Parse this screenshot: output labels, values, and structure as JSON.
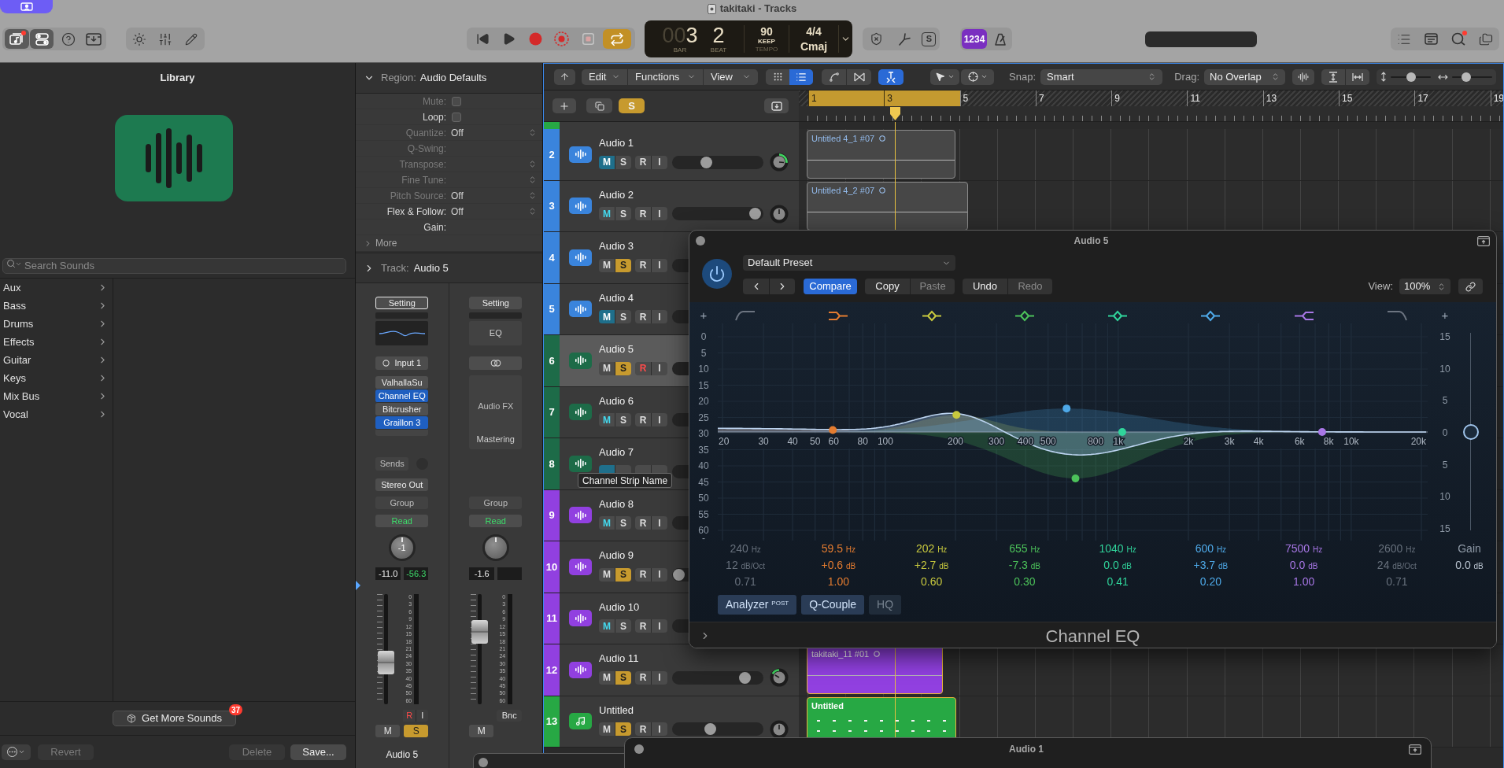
{
  "window": {
    "title": "takitaki - Tracks"
  },
  "toolbar": {
    "library_on": true,
    "inspector_on": true,
    "cycle_on": true,
    "solo_label": "S",
    "count_in": {
      "label": "1234",
      "on": true
    },
    "metronome_on": false,
    "lcd": {
      "bar_lead": "00",
      "bar": "3",
      "beat": "2",
      "bar_label": "BAR",
      "beat_label": "BEAT",
      "tempo": "90",
      "tempo_mode": "KEEP",
      "tempo_label": "TEMPO",
      "signature": "4/4",
      "key": "Cmaj"
    }
  },
  "library": {
    "title": "Library",
    "search": {
      "placeholder": "Search Sounds"
    },
    "categories": [
      "Aux",
      "Bass",
      "Drums",
      "Effects",
      "Guitar",
      "Keys",
      "Mix Bus",
      "Vocal"
    ],
    "get_more": {
      "label": "Get More Sounds",
      "badge": "37"
    },
    "buttons": [
      {
        "label": "Revert",
        "disabled": true
      },
      {
        "label": "Delete",
        "disabled": true
      },
      {
        "label": "Save...",
        "disabled": false
      }
    ]
  },
  "inspector": {
    "region": {
      "label": "Region:",
      "name": "Audio Defaults",
      "expanded": true,
      "rows": [
        {
          "label": "Mute:",
          "kind": "checkbox",
          "checked": false,
          "disabled": true
        },
        {
          "label": "Loop:",
          "kind": "checkbox",
          "checked": false,
          "disabled": false
        },
        {
          "label": "Quantize:",
          "kind": "popup",
          "value": "Off",
          "disabled": true
        },
        {
          "label": "Q-Swing:",
          "kind": "plain",
          "disabled": true
        },
        {
          "label": "Transpose:",
          "kind": "popup",
          "disabled": true
        },
        {
          "label": "Fine Tune:",
          "kind": "popup",
          "disabled": true
        },
        {
          "label": "Pitch Source:",
          "kind": "popup",
          "value": "Off",
          "disabled": true
        },
        {
          "label": "Flex & Follow:",
          "kind": "popup",
          "value": "Off",
          "disabled": false
        },
        {
          "label": "Gain:",
          "kind": "plain",
          "disabled": false
        }
      ],
      "more": "More"
    },
    "track": {
      "label": "Track:",
      "name": "Audio 5",
      "expanded": false
    },
    "strips": [
      {
        "selected": true,
        "setting": "Setting",
        "eq": {
          "kind": "curve"
        },
        "input": {
          "kind": "mono",
          "label": "Input 1"
        },
        "plugins": [
          {
            "name": "ValhallaSu",
            "selected": false
          },
          {
            "name": "Channel EQ",
            "selected": true
          },
          {
            "name": "Bitcrusher",
            "selected": false
          },
          {
            "name": "Graillon 3",
            "selected": true
          }
        ],
        "sends": "Sends",
        "output": "Stereo Out",
        "group": "Group",
        "automation": "Read",
        "pan_label": "-1",
        "volume": "-11.0",
        "peak": "-56.3",
        "fader": {
          "level": 0.38
        },
        "meter_scale": [
          "0",
          "3",
          "6",
          "9",
          "12",
          "15",
          "18",
          "21",
          "24",
          "30",
          "35",
          "40",
          "45",
          "50",
          "60"
        ],
        "buttons_top": [
          {
            "label": "R",
            "kind": "rec",
            "on": true
          },
          {
            "label": "I",
            "kind": "input",
            "on": false
          }
        ],
        "buttons_bottom": [
          {
            "label": "M",
            "kind": "mute",
            "on": false
          },
          {
            "label": "S",
            "kind": "solo",
            "on": true
          }
        ],
        "name": "Audio 5"
      },
      {
        "selected": false,
        "setting": "Setting",
        "eq": {
          "kind": "label",
          "label": "EQ"
        },
        "input": {
          "kind": "stereo"
        },
        "fx_box": {
          "placeholder": "Audio FX",
          "slot": "Mastering"
        },
        "group": "Group",
        "automation": "Read",
        "volume": "-1.6",
        "fader": {
          "level": 0.66
        },
        "meter_scale": [
          "0",
          "3",
          "6",
          "9",
          "12",
          "15",
          "18",
          "21",
          "24",
          "30",
          "35",
          "40",
          "45",
          "50",
          "60"
        ],
        "buttons_top": [
          {
            "label": "Bnc",
            "kind": "bounce",
            "on": false
          }
        ],
        "buttons_bottom": [
          {
            "label": "M",
            "kind": "mute",
            "on": false
          }
        ]
      }
    ]
  },
  "tracks_toolbar": {
    "menus": [
      "Edit",
      "Functions",
      "View"
    ],
    "grid_view_on": false,
    "list_view_on": true,
    "catch_on": true,
    "snap": {
      "label": "Snap:",
      "value": "Smart"
    },
    "drag": {
      "label": "Drag:",
      "value": "No Overlap"
    },
    "vertical_zoom": {
      "level": 0.5
    },
    "horizontal_zoom": {
      "level": 0.3
    }
  },
  "track_list_bar": {
    "solo": {
      "label": "S",
      "on": true
    }
  },
  "ruler": {
    "bars": [
      {
        "label": "1",
        "in_cycle": true
      },
      {
        "label": "3",
        "in_cycle": true
      },
      {
        "label": "5",
        "in_cycle": false
      },
      {
        "label": "7",
        "in_cycle": false
      },
      {
        "label": "9",
        "in_cycle": false
      },
      {
        "label": "11",
        "in_cycle": false
      },
      {
        "label": "13",
        "in_cycle": false
      },
      {
        "label": "15",
        "in_cycle": false
      },
      {
        "label": "17",
        "in_cycle": false
      },
      {
        "label": "19",
        "in_cycle": false
      }
    ],
    "playhead": {
      "level": 0.136
    }
  },
  "partial_track": {
    "color": "#27a844"
  },
  "tracks": [
    {
      "number": "2",
      "name": "Audio 1",
      "color": "#3a84dc",
      "kind": "audio",
      "selected": false,
      "solo_muted": false,
      "buttons": [
        {
          "label": "M",
          "kind": "mute",
          "on": true
        },
        {
          "label": "S",
          "kind": "solo",
          "on": false
        },
        {
          "label": "R",
          "kind": "rec",
          "on": false
        },
        {
          "label": "I",
          "kind": "input",
          "on": false
        }
      ],
      "volume": {
        "level": 0.35
      },
      "pan": {
        "left": false,
        "right": true
      },
      "region": {
        "name": "Untitled 4_1 #07",
        "kind": "audio",
        "selected": false,
        "loop": true
      }
    },
    {
      "number": "3",
      "name": "Audio 2",
      "color": "#3a84dc",
      "kind": "audio",
      "selected": false,
      "solo_muted": true,
      "buttons": [
        {
          "label": "M",
          "kind": "mute",
          "on": false
        },
        {
          "label": "S",
          "kind": "solo",
          "on": false
        },
        {
          "label": "R",
          "kind": "rec",
          "on": false
        },
        {
          "label": "I",
          "kind": "input",
          "on": false
        }
      ],
      "volume": {
        "level": 0.98
      },
      "pan": {
        "left": false,
        "right": false
      },
      "region": {
        "name": "Untitled 4_2 #07",
        "kind": "audio",
        "selected": false,
        "loop": true
      }
    },
    {
      "number": "4",
      "name": "Audio 3",
      "color": "#3a84dc",
      "kind": "audio",
      "selected": false,
      "solo_muted": false,
      "buttons": [
        {
          "label": "M",
          "kind": "mute",
          "on": false
        },
        {
          "label": "S",
          "kind": "solo",
          "on": true
        },
        {
          "label": "R",
          "kind": "rec",
          "on": false
        },
        {
          "label": "I",
          "kind": "input",
          "on": false
        }
      ]
    },
    {
      "number": "5",
      "name": "Audio 4",
      "color": "#3a84dc",
      "kind": "audio",
      "selected": false,
      "solo_muted": false,
      "buttons": [
        {
          "label": "M",
          "kind": "mute",
          "on": true
        },
        {
          "label": "S",
          "kind": "solo",
          "on": false
        },
        {
          "label": "R",
          "kind": "rec",
          "on": false
        },
        {
          "label": "I",
          "kind": "input",
          "on": false
        }
      ]
    },
    {
      "number": "6",
      "name": "Audio 5",
      "color": "#1d6b48",
      "kind": "audio",
      "selected": true,
      "solo_muted": false,
      "buttons": [
        {
          "label": "M",
          "kind": "mute",
          "on": false
        },
        {
          "label": "S",
          "kind": "solo",
          "on": true
        },
        {
          "label": "R",
          "kind": "rec",
          "on": true
        },
        {
          "label": "I",
          "kind": "input",
          "on": false
        }
      ]
    },
    {
      "number": "7",
      "name": "Audio 6",
      "color": "#1d6b48",
      "kind": "audio",
      "selected": false,
      "solo_muted": true,
      "buttons": [
        {
          "label": "M",
          "kind": "mute",
          "on": false
        },
        {
          "label": "S",
          "kind": "solo",
          "on": false
        },
        {
          "label": "R",
          "kind": "rec",
          "on": false
        },
        {
          "label": "I",
          "kind": "input",
          "on": false
        }
      ]
    },
    {
      "number": "8",
      "name": "Audio 7",
      "color": "#1d6b48",
      "kind": "audio",
      "selected": false,
      "solo_muted": false,
      "buttons": [
        {
          "kind": "mute",
          "on": true
        },
        {
          "kind": "solo",
          "on": false
        },
        {
          "kind": "rec"
        },
        {
          "kind": "input"
        }
      ]
    },
    {
      "number": "9",
      "name": "Audio 8",
      "color": "#9140e0",
      "kind": "audio",
      "selected": false,
      "solo_muted": true,
      "buttons": [
        {
          "label": "M",
          "kind": "mute",
          "on": false
        },
        {
          "label": "S",
          "kind": "solo",
          "on": false
        },
        {
          "label": "R",
          "kind": "rec",
          "on": false
        },
        {
          "label": "I",
          "kind": "input",
          "on": false
        }
      ]
    },
    {
      "number": "10",
      "name": "Audio 9",
      "color": "#9140e0",
      "kind": "audio",
      "selected": false,
      "solo_muted": false,
      "buttons": [
        {
          "label": "M",
          "kind": "mute",
          "on": false
        },
        {
          "label": "S",
          "kind": "solo",
          "on": true
        },
        {
          "label": "R",
          "kind": "rec",
          "on": false
        },
        {
          "label": "I",
          "kind": "input",
          "on": false
        }
      ],
      "volume": {
        "level": 0
      }
    },
    {
      "number": "11",
      "name": "Audio 10",
      "color": "#9140e0",
      "kind": "audio",
      "selected": false,
      "solo_muted": true,
      "buttons": [
        {
          "label": "M",
          "kind": "mute",
          "on": false
        },
        {
          "label": "S",
          "kind": "solo",
          "on": false
        },
        {
          "label": "R",
          "kind": "rec",
          "on": false
        },
        {
          "label": "I",
          "kind": "input",
          "on": false
        }
      ]
    },
    {
      "number": "12",
      "name": "Audio 11",
      "color": "#9140e0",
      "kind": "audio",
      "selected": false,
      "solo_muted": false,
      "buttons": [
        {
          "label": "M",
          "kind": "mute",
          "on": false
        },
        {
          "label": "S",
          "kind": "solo",
          "on": true
        },
        {
          "label": "R",
          "kind": "rec",
          "on": false
        },
        {
          "label": "I",
          "kind": "input",
          "on": false
        }
      ],
      "volume": {
        "level": 0.85
      },
      "pan": {
        "left": true,
        "right": false
      },
      "region": {
        "name": "takitaki_11 #01",
        "kind": "audio",
        "selected": true,
        "loop": true
      }
    },
    {
      "number": "13",
      "name": "Untitled",
      "color": "#27a844",
      "kind": "instrument",
      "selected": false,
      "solo_muted": false,
      "buttons": [
        {
          "label": "M",
          "kind": "mute",
          "on": false
        },
        {
          "label": "S",
          "kind": "solo",
          "on": true
        },
        {
          "label": "R",
          "kind": "rec",
          "on": false
        },
        {
          "label": "I",
          "kind": "input",
          "on": false
        }
      ],
      "volume": {
        "level": 0.4
      },
      "pan": {
        "left": false,
        "right": false
      },
      "region": {
        "name": "Untitled",
        "kind": "midi",
        "selected": true
      }
    }
  ],
  "tooltip": "Channel Strip Name",
  "plugin_window": {
    "title": "Audio 5",
    "power_on": true,
    "preset": "Default Preset",
    "button_groups": [
      [
        {
          "label": "Compare",
          "on": true
        }
      ],
      [
        {
          "label": "Copy",
          "disabled": false
        },
        {
          "label": "Paste",
          "disabled": true
        }
      ],
      [
        {
          "label": "Undo",
          "disabled": false
        },
        {
          "label": "Redo",
          "disabled": true
        }
      ]
    ],
    "view": {
      "label": "View:",
      "value": "100%"
    },
    "left_scale": {
      "plus": "+",
      "minus": "-",
      "labels": [
        "0",
        "5",
        "10",
        "15",
        "20",
        "25",
        "30",
        "35",
        "40",
        "45",
        "50",
        "55",
        "60"
      ]
    },
    "right_scale": {
      "plus": "+",
      "labels": [
        "15",
        "10",
        "5",
        "0",
        "5",
        "10",
        "15"
      ]
    },
    "frequencies": [
      "20",
      "30",
      "40",
      "50",
      "60",
      "80",
      "100",
      "200",
      "300",
      "400",
      "500",
      "800",
      "1k",
      "2k",
      "3k",
      "4k",
      "6k",
      "8k",
      "10k",
      "20k"
    ],
    "bands": [
      {
        "kind": "low_cut",
        "on": false,
        "freq": "240",
        "freq_unit": "Hz",
        "gain": "12",
        "gain_unit": "dB/Oct",
        "q": "0.71"
      },
      {
        "kind": "low_shelf",
        "on": true,
        "color": "#e47c30",
        "freq": "59.5",
        "freq_unit": "Hz",
        "gain": "+0.6",
        "gain_unit": "dB",
        "q": "1.00"
      },
      {
        "kind": "bell",
        "on": true,
        "color": "#c8c93e",
        "freq": "202",
        "freq_unit": "Hz",
        "gain": "+2.7",
        "gain_unit": "dB",
        "q": "0.60"
      },
      {
        "kind": "bell",
        "on": true,
        "color": "#4cc25a",
        "freq": "655",
        "freq_unit": "Hz",
        "gain": "-7.3",
        "gain_unit": "dB",
        "q": "0.30"
      },
      {
        "kind": "bell",
        "on": true,
        "color": "#30d49b",
        "freq": "1040",
        "freq_unit": "Hz",
        "gain": "0.0",
        "gain_unit": "dB",
        "q": "0.41"
      },
      {
        "kind": "bell",
        "on": true,
        "color": "#4ea9e8",
        "freq": "600",
        "freq_unit": "Hz",
        "gain": "+3.7",
        "gain_unit": "dB",
        "q": "0.20"
      },
      {
        "kind": "high_shelf",
        "on": true,
        "color": "#a877e6",
        "freq": "7500",
        "freq_unit": "Hz",
        "gain": "0.0",
        "gain_unit": "dB",
        "q": "1.00"
      },
      {
        "kind": "high_cut",
        "on": false,
        "freq": "2600",
        "freq_unit": "Hz",
        "gain": "24",
        "gain_unit": "dB/Oct",
        "q": "0.71"
      }
    ],
    "gain": {
      "label": "Gain",
      "value": "0.0",
      "unit": "dB",
      "level": 0.5
    },
    "options": [
      {
        "label": "Analyzer $^{POST}$",
        "on": true
      },
      {
        "label": "Q-Couple",
        "on": true
      },
      {
        "label": "HQ",
        "on": false
      }
    ],
    "name": "Channel EQ"
  },
  "back_window": {
    "title": "Audio 1"
  }
}
